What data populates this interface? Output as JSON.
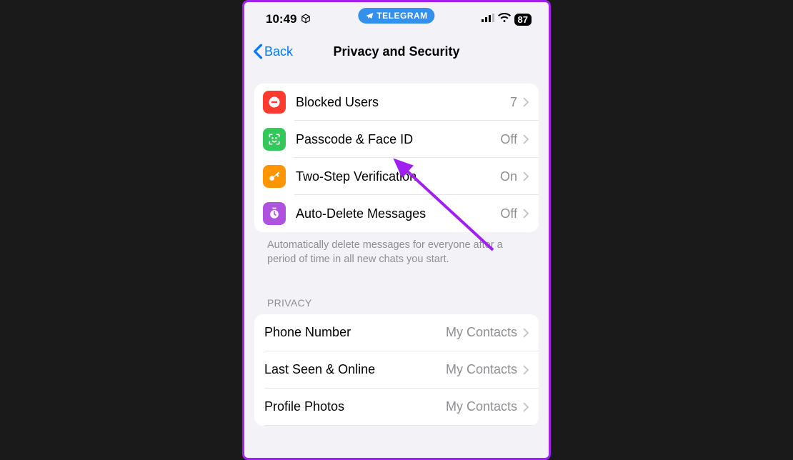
{
  "statusbar": {
    "time": "10:49",
    "app_badge": "TELEGRAM",
    "battery": "87"
  },
  "nav": {
    "back_label": "Back",
    "title": "Privacy and Security"
  },
  "security_section": {
    "items": [
      {
        "label": "Blocked Users",
        "value": "7"
      },
      {
        "label": "Passcode & Face ID",
        "value": "Off"
      },
      {
        "label": "Two-Step Verification",
        "value": "On"
      },
      {
        "label": "Auto-Delete Messages",
        "value": "Off"
      }
    ],
    "footer": "Automatically delete messages for everyone after a period of time in all new chats you start."
  },
  "privacy_header": "PRIVACY",
  "privacy_section": {
    "items": [
      {
        "label": "Phone Number",
        "value": "My Contacts"
      },
      {
        "label": "Last Seen & Online",
        "value": "My Contacts"
      },
      {
        "label": "Profile Photos",
        "value": "My Contacts"
      }
    ]
  }
}
